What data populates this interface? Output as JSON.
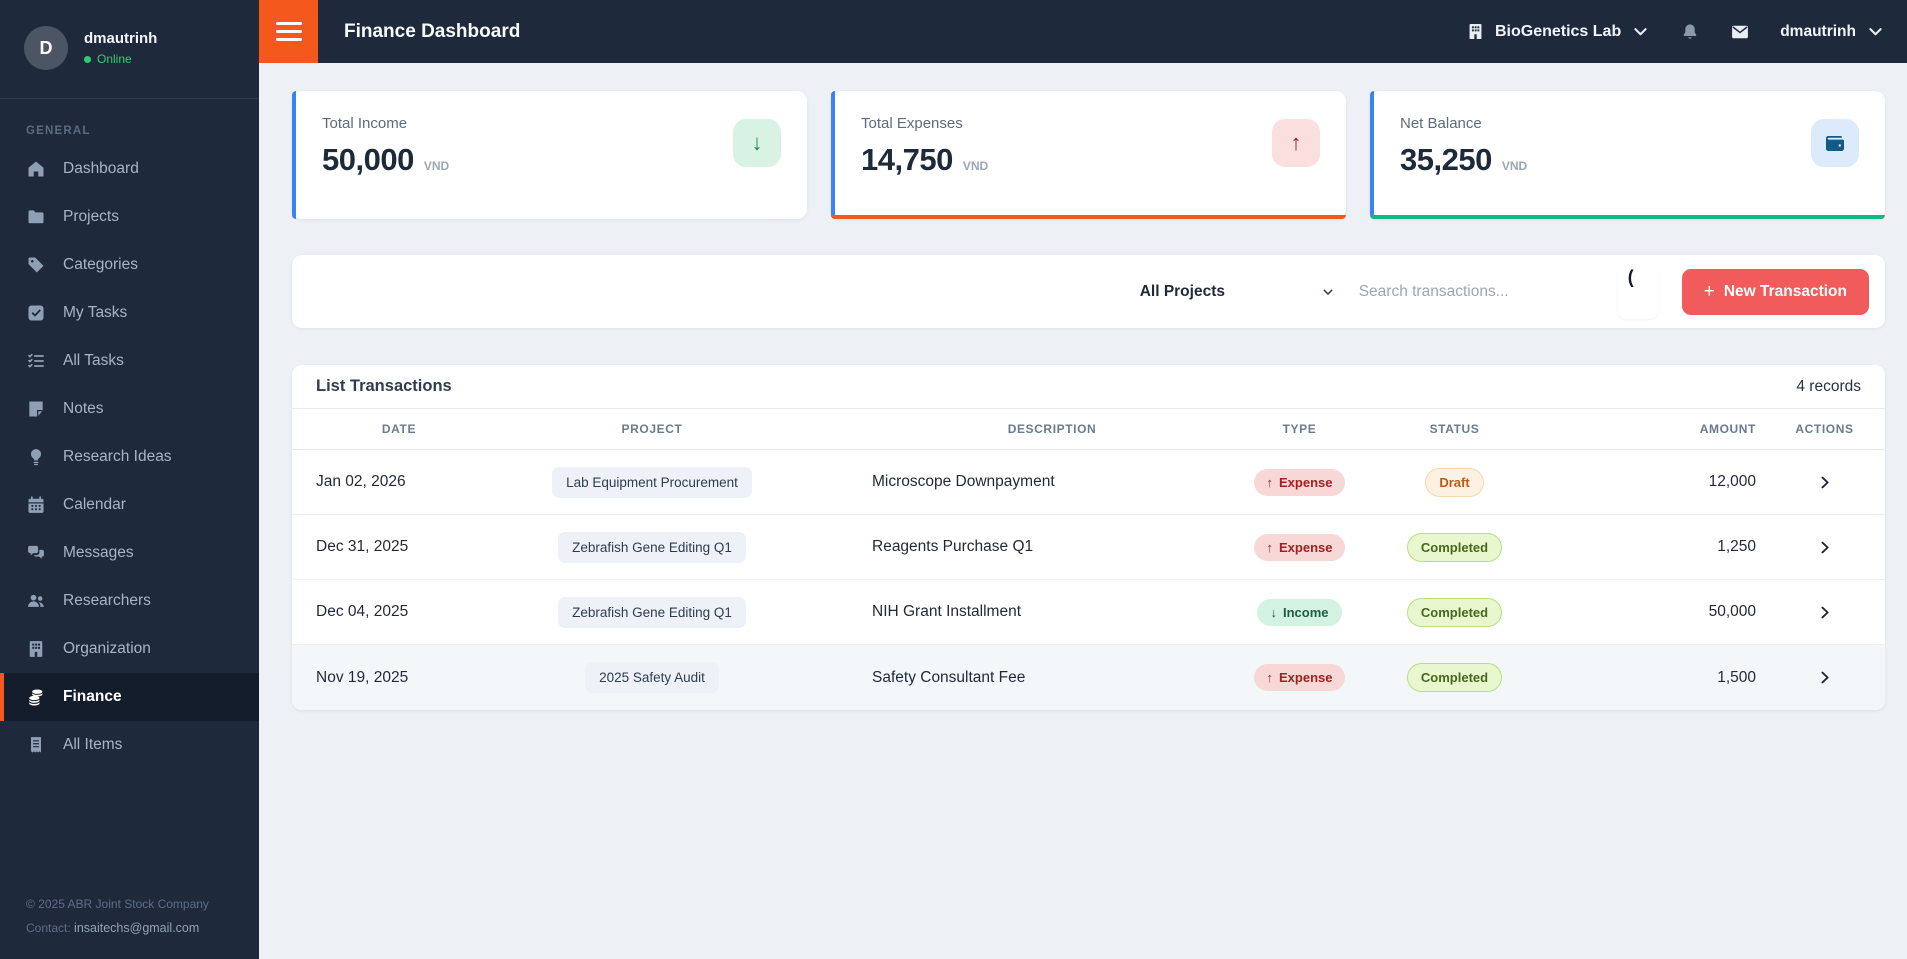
{
  "topbar": {
    "title": "Finance Dashboard",
    "org": {
      "icon": "building-icon",
      "label": "BioGenetics Lab"
    },
    "user": {
      "label": "dmautrinh"
    }
  },
  "sidebar": {
    "user": {
      "initial": "D",
      "name": "dmautrinh",
      "status": "Online"
    },
    "section": "GENERAL",
    "items": [
      {
        "icon": "home-icon",
        "label": "Dashboard",
        "active": false
      },
      {
        "icon": "folder-icon",
        "label": "Projects",
        "active": false
      },
      {
        "icon": "tag-icon",
        "label": "Categories",
        "active": false
      },
      {
        "icon": "check-square-icon",
        "label": "My Tasks",
        "active": false
      },
      {
        "icon": "list-check-icon",
        "label": "All Tasks",
        "active": false
      },
      {
        "icon": "note-icon",
        "label": "Notes",
        "active": false
      },
      {
        "icon": "lightbulb-icon",
        "label": "Research Ideas",
        "active": false
      },
      {
        "icon": "calendar-icon",
        "label": "Calendar",
        "active": false
      },
      {
        "icon": "messages-icon",
        "label": "Messages",
        "active": false
      },
      {
        "icon": "users-icon",
        "label": "Researchers",
        "active": false
      },
      {
        "icon": "building-icon",
        "label": "Organization",
        "active": false
      },
      {
        "icon": "coins-icon",
        "label": "Finance",
        "active": true
      },
      {
        "icon": "receipt-icon",
        "label": "All Items",
        "active": false
      }
    ],
    "footer": {
      "line1": "© 2025 ABR Joint Stock Company",
      "contact_label": "Contact:",
      "contact_value": "insaitechs@gmail.com"
    }
  },
  "cards": [
    {
      "label": "Total Income",
      "value": "50,000",
      "currency": "VND",
      "icon": "arrow-down-icon",
      "icon_bg": "#d8f3e3",
      "icon_color": "#0b8a4b",
      "accent_left": "#3b82f6",
      "accent_bottom": ""
    },
    {
      "label": "Total Expenses",
      "value": "14,750",
      "currency": "VND",
      "icon": "arrow-up-icon",
      "icon_bg": "#fbdfdf",
      "icon_color": "#9f1d1d",
      "accent_left": "#3b82f6",
      "accent_bottom": "#f4581c"
    },
    {
      "label": "Net Balance",
      "value": "35,250",
      "currency": "VND",
      "icon": "wallet-icon",
      "icon_bg": "#dceafc",
      "icon_color": "#145a86",
      "accent_left": "#3b82f6",
      "accent_bottom": "#10b981"
    }
  ],
  "filterbar": {
    "project_select": "All Projects",
    "search_placeholder": "Search transactions...",
    "overflow_text": "(",
    "plus": "+",
    "new_button": "New Transaction"
  },
  "transactions": {
    "title": "List Transactions",
    "records": "4 records",
    "columns": [
      "DATE",
      "PROJECT",
      "DESCRIPTION",
      "TYPE",
      "STATUS",
      "AMOUNT",
      "ACTIONS"
    ],
    "rows": [
      {
        "date": "Jan 02, 2026",
        "project": "Lab Equipment Procurement",
        "description": "Microscope Downpayment",
        "type": "Expense",
        "arrow": "↑",
        "status": "Draft",
        "amount": "12,000"
      },
      {
        "date": "Dec 31, 2025",
        "project": "Zebrafish Gene Editing Q1",
        "description": "Reagents Purchase Q1",
        "type": "Expense",
        "arrow": "↑",
        "status": "Completed",
        "amount": "1,250"
      },
      {
        "date": "Dec 04, 2025",
        "project": "Zebrafish Gene Editing Q1",
        "description": "NIH Grant Installment",
        "type": "Income",
        "arrow": "↓",
        "status": "Completed",
        "amount": "50,000"
      },
      {
        "date": "Nov 19, 2025",
        "project": "2025 Safety Audit",
        "description": "Safety Consultant Fee",
        "type": "Expense",
        "arrow": "↑",
        "status": "Completed",
        "amount": "1,500"
      }
    ]
  },
  "colors": {
    "brand_orange": "#f4581c",
    "button_red": "#f25b5b",
    "accent_blue": "#3b82f6",
    "accent_green": "#10b981",
    "sidebar_bg": "#1e293b",
    "online_green": "#2ecc71"
  }
}
